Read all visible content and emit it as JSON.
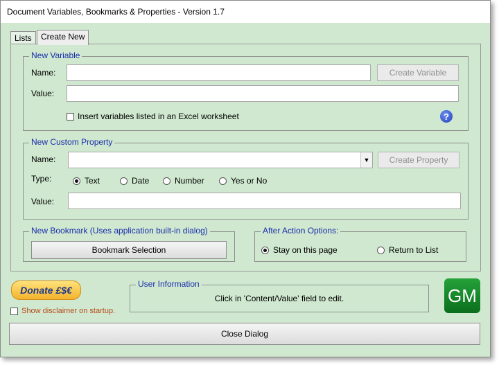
{
  "window": {
    "title": "Document Variables, Bookmarks & Properties - Version 1.7"
  },
  "tabs": [
    {
      "label": "Lists",
      "active": false
    },
    {
      "label": "Create New",
      "active": true
    }
  ],
  "new_variable": {
    "legend": "New Variable",
    "name_label": "Name:",
    "name_value": "",
    "value_label": "Value:",
    "value_value": "",
    "create_button": "Create Variable",
    "excel_checkbox_label": "Insert variables listed in an Excel worksheet",
    "excel_checked": false,
    "help_icon": "?"
  },
  "new_custom_property": {
    "legend": "New Custom Property",
    "name_label": "Name:",
    "name_value": "",
    "create_button": "Create Property",
    "type_label": "Type:",
    "types": [
      {
        "label": "Text",
        "checked": true
      },
      {
        "label": "Date",
        "checked": false
      },
      {
        "label": "Number",
        "checked": false
      },
      {
        "label": "Yes or No",
        "checked": false
      }
    ],
    "value_label": "Value:",
    "value_value": ""
  },
  "new_bookmark": {
    "legend": "New Bookmark (Uses application built-in dialog)",
    "button": "Bookmark Selection"
  },
  "after_action": {
    "legend": "After Action Options:",
    "options": [
      {
        "label": "Stay on this page",
        "checked": true
      },
      {
        "label": "Return to List",
        "checked": false
      }
    ]
  },
  "footer": {
    "donate_label": "Donate £$€",
    "disclaimer_label": "Show disclaimer on startup.",
    "disclaimer_checked": false,
    "user_info_legend": "User Information",
    "user_info_text": "Click in 'Content/Value' field to edit.",
    "logo_text": "GM",
    "close_button": "Close Dialog"
  },
  "colors": {
    "background": "#cfe8cf",
    "legend_text": "#1a2dab",
    "disclaimer_text": "#b84a1a",
    "logo_green": "#1a8a2e",
    "donate_gold": "#f3b32c"
  }
}
